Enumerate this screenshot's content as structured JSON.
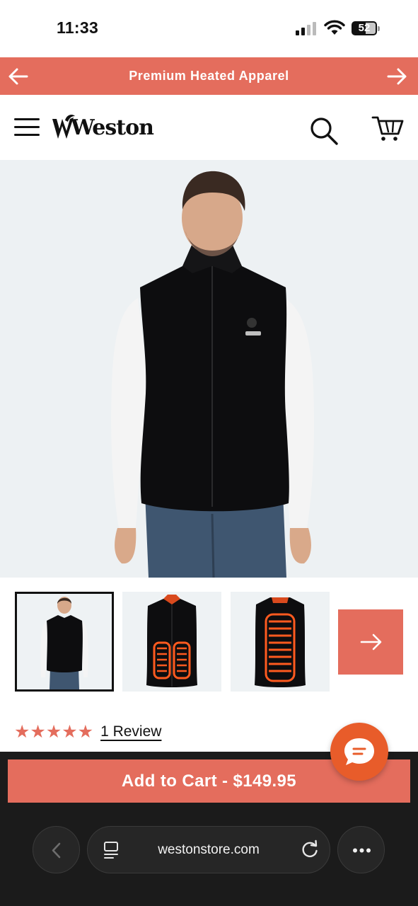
{
  "status_bar": {
    "time": "11:33",
    "battery_level": "52",
    "icons": [
      "signal-icon",
      "wifi-icon",
      "battery-icon"
    ]
  },
  "promo_bar": {
    "text": "Premium Heated Apparel",
    "background": "#e46d5d",
    "prev_icon": "arrow-left-icon",
    "next_icon": "arrow-right-icon"
  },
  "header": {
    "logo_text": "Weston",
    "menu_icon": "hamburger-menu-icon",
    "search_icon": "search-icon",
    "cart_icon": "cart-icon"
  },
  "product": {
    "images": [
      {
        "name": "model wearing black heated vest",
        "active": true
      },
      {
        "name": "vest front with heating panels",
        "active": false
      },
      {
        "name": "vest back with heating panel",
        "active": false
      }
    ],
    "rating_stars": "★★★★★",
    "rating_value": 5,
    "review_link": "1 Review",
    "add_to_cart_label": "Add to Cart - $149.95",
    "accent_color": "#e46d5d"
  },
  "chat": {
    "icon": "chat-bubble-icon",
    "color": "#e85c2a"
  },
  "browser": {
    "url": "westonstore.com",
    "back_icon": "chevron-left-icon",
    "reader_icon": "reader-mode-icon",
    "reload_icon": "reload-icon",
    "more_icon": "ellipsis-icon"
  }
}
